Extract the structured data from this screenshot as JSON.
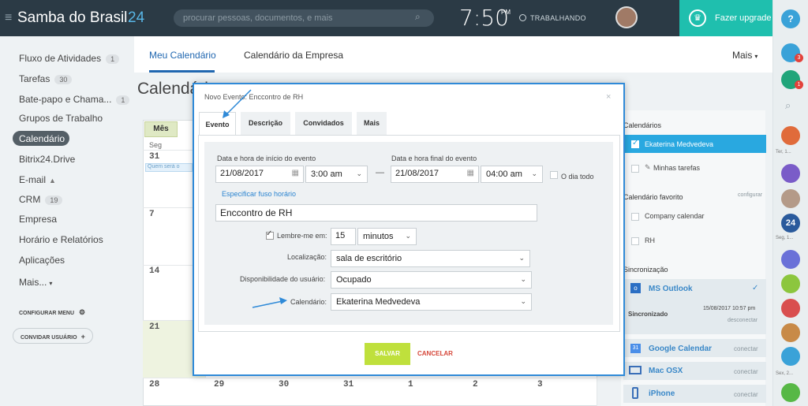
{
  "header": {
    "brand": "Samba do Brasil",
    "brand_suffix": "24",
    "search_placeholder": "procurar pessoas, documentos, e mais",
    "time": "7:50",
    "time_suffix": "PM",
    "status": "TRABALHANDO",
    "upgrade_label": "Fazer upgrade",
    "help": "?"
  },
  "sidebar": {
    "items": [
      {
        "label": "Fluxo de Atividades",
        "count": "1"
      },
      {
        "label": "Tarefas",
        "count": "30"
      },
      {
        "label": "Bate-papo e Chama...",
        "count": "1"
      },
      {
        "label": "Grupos de Trabalho",
        "count": ""
      },
      {
        "label": "Calendário",
        "count": ""
      },
      {
        "label": "Bitrix24.Drive",
        "count": ""
      },
      {
        "label": "E-mail",
        "count": ""
      },
      {
        "label": "CRM",
        "count": "19"
      },
      {
        "label": "Empresa",
        "count": ""
      },
      {
        "label": "Horário e Relatórios",
        "count": ""
      },
      {
        "label": "Aplicações",
        "count": ""
      },
      {
        "label": "Mais...",
        "count": ""
      }
    ],
    "config_menu": "CONFIGURAR MENU",
    "invite": "CONVIDAR USUÁRIO"
  },
  "tabs": {
    "my_calendar": "Meu Calendário",
    "company_calendar": "Calendário da Empresa",
    "more": "Mais"
  },
  "page_title": "Calendário",
  "calendar": {
    "view_button": "Mês",
    "weekday": "Seg",
    "event_preview": "Quem será o",
    "rows": [
      [
        "31"
      ],
      [
        "7"
      ],
      [
        "14"
      ],
      [
        "21"
      ],
      [
        "28",
        "29",
        "30",
        "31",
        "1",
        "2",
        "3"
      ]
    ]
  },
  "right_panel": {
    "calendars_title": "Calendários",
    "calendar_owner": "Ekaterina Medvedeva",
    "my_tasks": "Minhas tarefas",
    "favorites_title": "Calendário favorito",
    "configure": "configurar",
    "company_calendar": "Company calendar",
    "hr": "RH",
    "sync_title": "Sincronização",
    "outlook": "MS Outlook",
    "synced": "Sincronizado",
    "synced_date": "15/08/2017 10:57 pm",
    "disconnect": "desconectar",
    "google": "Google Calendar",
    "macosx": "Mac OSX",
    "iphone": "iPhone",
    "connect": "conectar"
  },
  "right_strip": {
    "badge1": "3",
    "badge2": "1",
    "u1": "Ter, 1...",
    "u3": "Seg, 1...",
    "u4": "Sex, 2..."
  },
  "modal": {
    "title": "Novo Evento: Enccontro de RH",
    "close": "×",
    "tabs": [
      "Evento",
      "Descrição",
      "Convidados",
      "Mais"
    ],
    "start_label": "Data e hora de início do evento",
    "end_label": "Data e hora final do evento",
    "start_date": "21/08/2017",
    "start_time": "3:00 am",
    "end_date": "21/08/2017",
    "end_time": "04:00 am",
    "dash": "—",
    "all_day": "O dia todo",
    "timezone_link": "Especificar fuso horário",
    "event_name": "Enccontro de RH",
    "remind_label": "Lembre-me em:",
    "remind_value": "15",
    "remind_unit": "minutos",
    "location_label": "Localização:",
    "location_value": "sala de escritório",
    "availability_label": "Disponibilidade do usuário:",
    "availability_value": "Ocupado",
    "calendar_label": "Calendário:",
    "calendar_value": "Ekaterina Medvedeva",
    "save": "SALVAR",
    "cancel": "CANCELAR"
  },
  "colors": {
    "topbar": "#2b3a45",
    "accent_blue": "#2f8ad8",
    "upgrade": "#1fbfae",
    "save": "#bfe03c",
    "cancel": "#d6473a"
  }
}
